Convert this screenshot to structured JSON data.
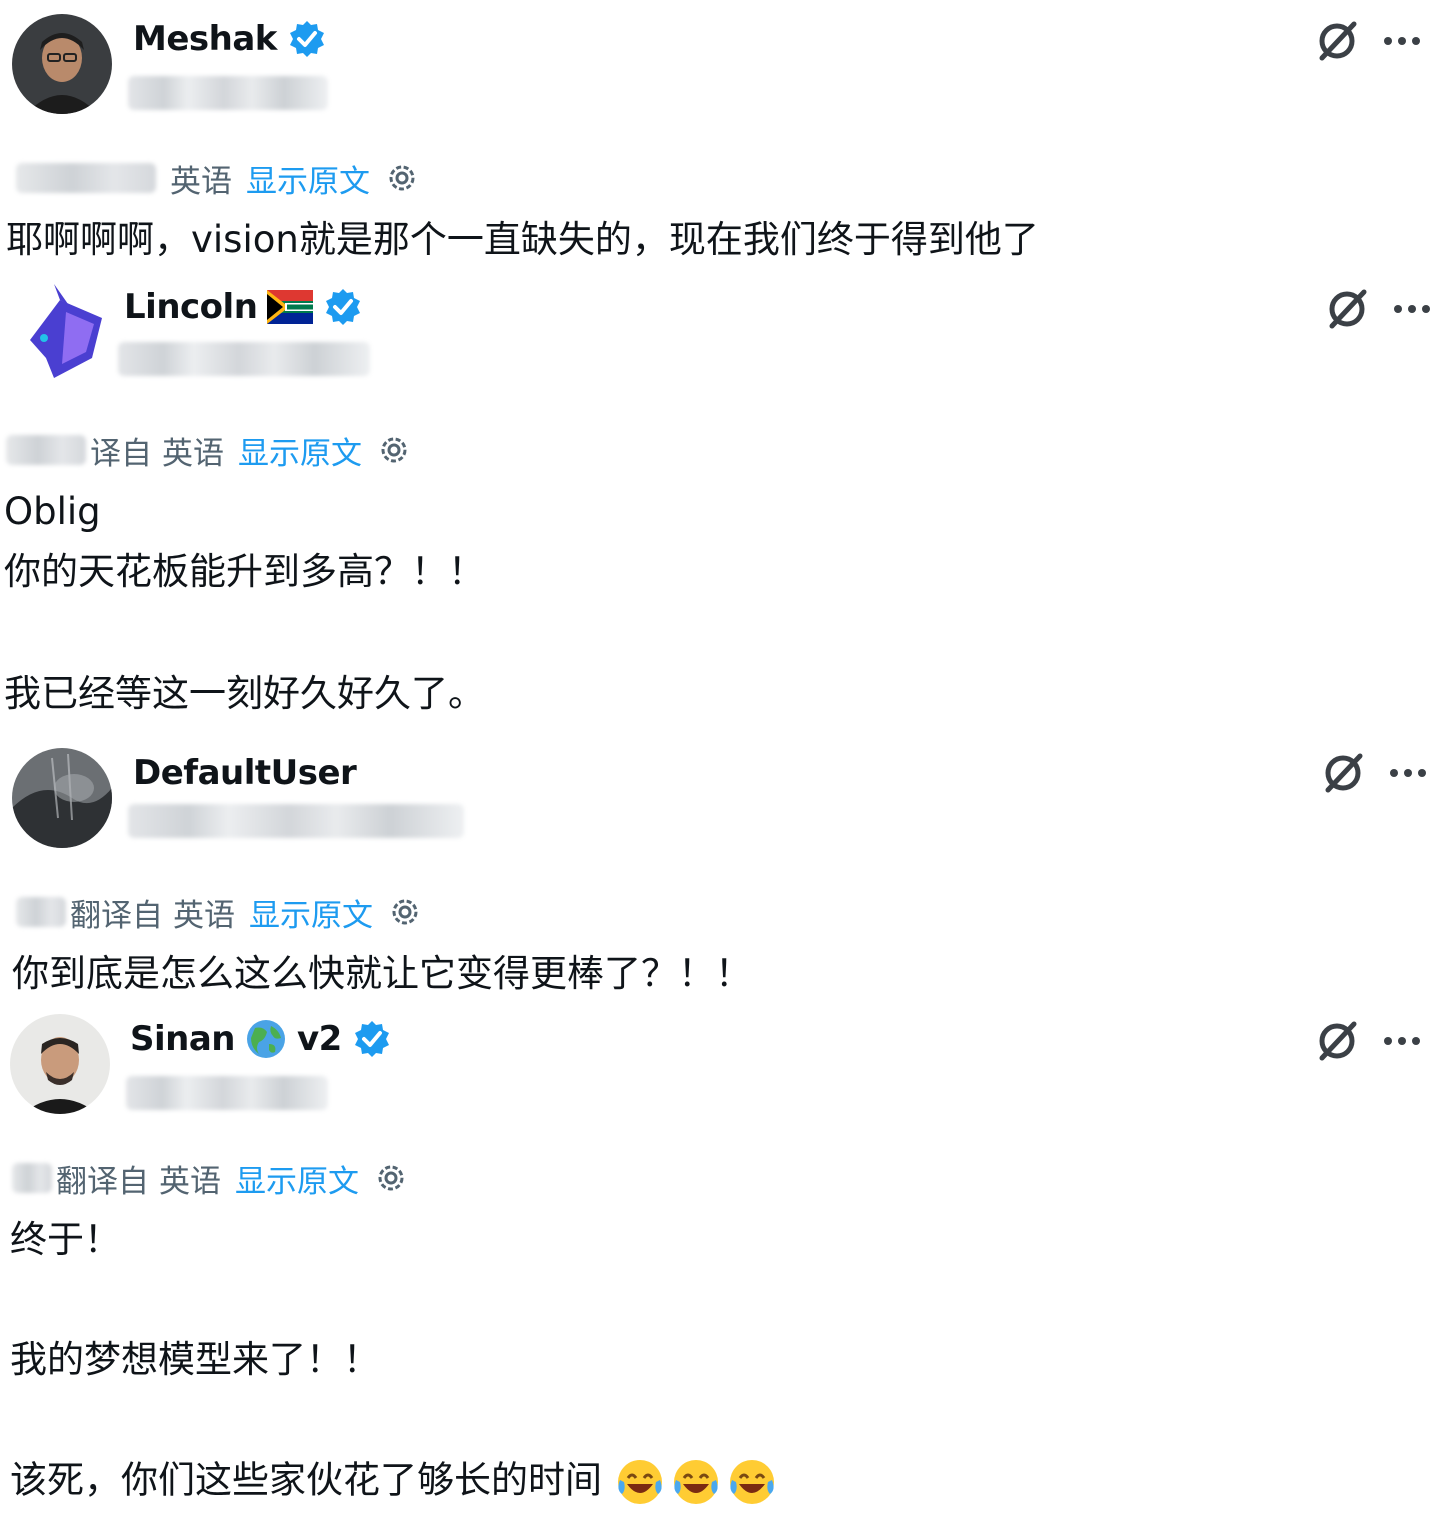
{
  "posts": [
    {
      "name": "Meshak",
      "verified": true,
      "translate_prefix": "",
      "translate_lang": "英语",
      "translate_show_original": "显示原文",
      "lines": [
        "耶啊啊啊，vision就是那个一直缺失的，现在我们终于得到他了"
      ]
    },
    {
      "name": "Lincoln",
      "verified": true,
      "flag": "south-africa-flag",
      "translate_prefix": "译自",
      "translate_lang": "英语",
      "translate_show_original": "显示原文",
      "lines": [
        "Oblig",
        "你的天花板能升到多高？！！",
        "我已经等这一刻好久好久了。"
      ]
    },
    {
      "name": "DefaultUser",
      "verified": false,
      "translate_prefix": "翻译自",
      "translate_lang": "英语",
      "translate_show_original": "显示原文",
      "lines": [
        "你到底是怎么这么快就让它变得更棒了？！！"
      ]
    },
    {
      "name": "Sinan",
      "name_suffix": "v2",
      "verified": true,
      "globe": "globe-icon",
      "translate_prefix": "翻译自",
      "translate_lang": "英语",
      "translate_show_original": "显示原文",
      "lines": [
        "终于！",
        "我的梦想模型来了！！",
        "该死，你们这些家伙花了够长的时间"
      ],
      "emojis": [
        "face-with-tears-of-joy",
        "face-with-tears-of-joy",
        "face-with-tears-of-joy"
      ]
    }
  ],
  "colors": {
    "text": "#0f1419",
    "secondary": "#536471",
    "link": "#1d9bf0",
    "verified": "#1d9bf0"
  },
  "icons": {
    "grok": "grok-icon",
    "more": "more-icon",
    "settings": "gear-icon",
    "verified": "verified-badge-icon"
  }
}
